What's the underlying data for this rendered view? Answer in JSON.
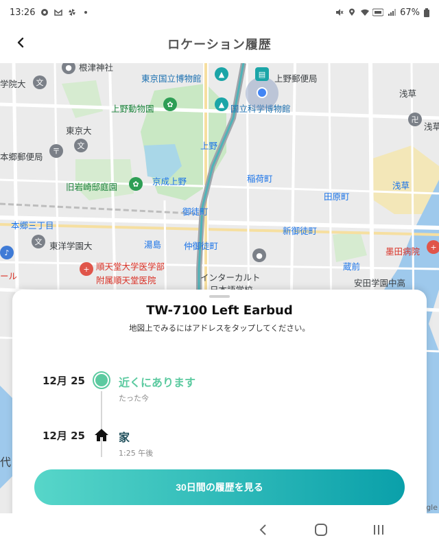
{
  "status_bar": {
    "time": "13:26",
    "battery_percent": "67%",
    "icons": [
      "camera-dot-icon",
      "gmail-icon",
      "pinwheel-icon",
      "dot-icon",
      "mute-icon",
      "location-icon",
      "wifi-icon",
      "volte-icon",
      "signal-icon",
      "battery-icon"
    ]
  },
  "header": {
    "title": "ロケーション履歴",
    "back_icon": "chevron-left-icon"
  },
  "map": {
    "labels": {
      "negishi": "根津神社",
      "gakuin": "学院大",
      "tokyo_museum": "東京国立博物館",
      "ueno_post": "上野郵便局",
      "asakusa": "浅草",
      "ueno_zoo": "上野動物園",
      "science_museum": "国立科学博物館",
      "todai": "東京大",
      "hongo_post": "本郷郵便局",
      "asakusa2": "浅草",
      "ueno": "上野",
      "inaricho": "稲荷町",
      "iwasaki": "旧岩崎邸庭園",
      "keisei_ueno": "京成上野",
      "tawaramachi": "田原町",
      "asakusa_sta": "浅草",
      "okachimachi": "御徒町",
      "hongo3": "本郷三丁目",
      "shin_okachimachi": "新御徒町",
      "yushima": "湯島",
      "toyo_gakuen": "東洋学園大",
      "naka_okachimachi": "仲御徒町",
      "juntendo": "順天堂大学医学部",
      "juntendo2": "附属順天堂医院",
      "bokuto": "墨田病院",
      "kuramae": "蔵前",
      "interculture": "インターカルト",
      "nihongo": "日本語学校",
      "yasuda": "安田学園中高",
      "hall": "ール",
      "dai": "代"
    },
    "google_mark": "gle"
  },
  "sheet": {
    "device_name": "TW-7100 Left Earbud",
    "instruction": "地図上でみるにはアドレスをタップしてください。",
    "entries": [
      {
        "date": "12月 25",
        "title": "近くにあります",
        "subtitle": "たった今",
        "marker": "current-location-dot-icon"
      },
      {
        "date": "12月 25",
        "title": "家",
        "subtitle": "1:25 午後",
        "marker": "home-icon"
      }
    ],
    "history_button": "30日間の履歴を見る"
  },
  "colors": {
    "accent_green": "#5ccaa0",
    "button_gradient_start": "#57d6c9",
    "button_gradient_end": "#0aa0aa",
    "home_title": "#1e4e5a"
  }
}
